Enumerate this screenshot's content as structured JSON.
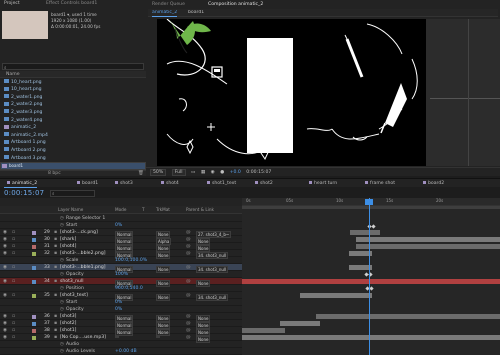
{
  "project": {
    "tabs": [
      "Project",
      "Effect Controls board1"
    ],
    "selected": {
      "name": "board1 ▾",
      "used": ", used 1 time",
      "size": "1920 x 1080 (1.00)",
      "duration": "Δ 0:00:00:01, 24.00 fps"
    },
    "name_header": "Name",
    "items": [
      {
        "name": "10_heart.png",
        "color": "#5b8dc4"
      },
      {
        "name": "10_heart.png",
        "color": "#5b8dc4"
      },
      {
        "name": "2_water1.png",
        "color": "#5b8dc4"
      },
      {
        "name": "2_water2.png",
        "color": "#5b8dc4"
      },
      {
        "name": "2_water3.png",
        "color": "#5b8dc4"
      },
      {
        "name": "2_water4.png",
        "color": "#5b8dc4"
      },
      {
        "name": "animatic_2",
        "color": "#a090c0"
      },
      {
        "name": "animatic_2.mp4",
        "color": "#5b8dc4"
      },
      {
        "name": "Artboard 1.png",
        "color": "#5b8dc4"
      },
      {
        "name": "Artboard 2.png",
        "color": "#5b8dc4"
      },
      {
        "name": "Artboard 3.png",
        "color": "#5b8dc4"
      },
      {
        "name": "board1",
        "color": "#a090c0",
        "selected": true
      }
    ],
    "bpc": "8 bpc"
  },
  "viewer": {
    "tabs": [
      "Render Queue",
      "Composition animatic_2"
    ],
    "subtabs": [
      "animatic_2",
      "board1"
    ],
    "zoom": "50%",
    "resolution": "Full",
    "exposure": "+0.0",
    "timecode": "0:00:15:07"
  },
  "timeline": {
    "tabs": [
      "animatic_2",
      "board1",
      "shot3",
      "shot4",
      "shot1_text",
      "shot2",
      "heart turn",
      "frame shot",
      "board2"
    ],
    "timecode": "0:00:15:07",
    "frames": "00367 (24.00 fps)",
    "columns": {
      "layer_name": "Layer Name",
      "mode": "Mode",
      "t": "T",
      "trkmat": "TrkMat",
      "parent": "Parent & Link"
    },
    "ruler": [
      "0s",
      "05s",
      "10s",
      "15s",
      "20s"
    ],
    "rows": [
      {
        "type": "prop",
        "label": "Range Selector 1"
      },
      {
        "type": "prop",
        "label": "Start",
        "value": "0%"
      },
      {
        "type": "layer",
        "num": "29",
        "name": "[shot3-...ck.png]",
        "mode": "Normal",
        "trk": "None",
        "parent": "27. shot3_4_b~"
      },
      {
        "type": "layer",
        "num": "30",
        "name": "[shark]",
        "mode": "Normal",
        "trk": "Alpha",
        "parent": "None"
      },
      {
        "type": "layer",
        "num": "31",
        "name": "[shot4]",
        "mode": "Normal",
        "trk": "None",
        "parent": "None"
      },
      {
        "type": "layer",
        "num": "32",
        "name": "[shot3-...bble2.png]",
        "mode": "Normal",
        "trk": "None",
        "parent": "34. shot3_null"
      },
      {
        "type": "prop",
        "label": "Scale",
        "value": "100.0,100.0%"
      },
      {
        "type": "layer",
        "num": "33",
        "name": "[shot3-...bble1.png]",
        "mode": "Normal",
        "trk": "None",
        "parent": "34. shot3_null",
        "hl": true
      },
      {
        "type": "prop",
        "label": "Opacity",
        "value": "100%"
      },
      {
        "type": "layer",
        "num": "34",
        "name": "shot3_null",
        "mode": "Normal",
        "trk": "None",
        "parent": "None",
        "red": true
      },
      {
        "type": "prop",
        "label": "Position",
        "value": "960.0,540.0"
      },
      {
        "type": "layer",
        "num": "35",
        "name": "[shot3_text]",
        "mode": "Normal",
        "trk": "None",
        "parent": "34. shot3_null"
      },
      {
        "type": "prop",
        "label": "Start",
        "value": "0%"
      },
      {
        "type": "prop",
        "label": "Opacity",
        "value": "0%"
      },
      {
        "type": "layer",
        "num": "36",
        "name": "[shot3]",
        "mode": "Normal",
        "trk": "None",
        "parent": "None"
      },
      {
        "type": "layer",
        "num": "37",
        "name": "[shot2]",
        "mode": "Normal",
        "trk": "None",
        "parent": "None"
      },
      {
        "type": "layer",
        "num": "38",
        "name": "[shot1]",
        "mode": "Normal",
        "trk": "None",
        "parent": "None"
      },
      {
        "type": "layer",
        "num": "39",
        "name": "[No Cop....use.mp3]",
        "mode": "",
        "trk": "",
        "parent": "None"
      },
      {
        "type": "prop",
        "label": "Audio",
        "value": ""
      },
      {
        "type": "prop",
        "label": "Audio Levels",
        "value": "+0.00 dB"
      }
    ]
  }
}
